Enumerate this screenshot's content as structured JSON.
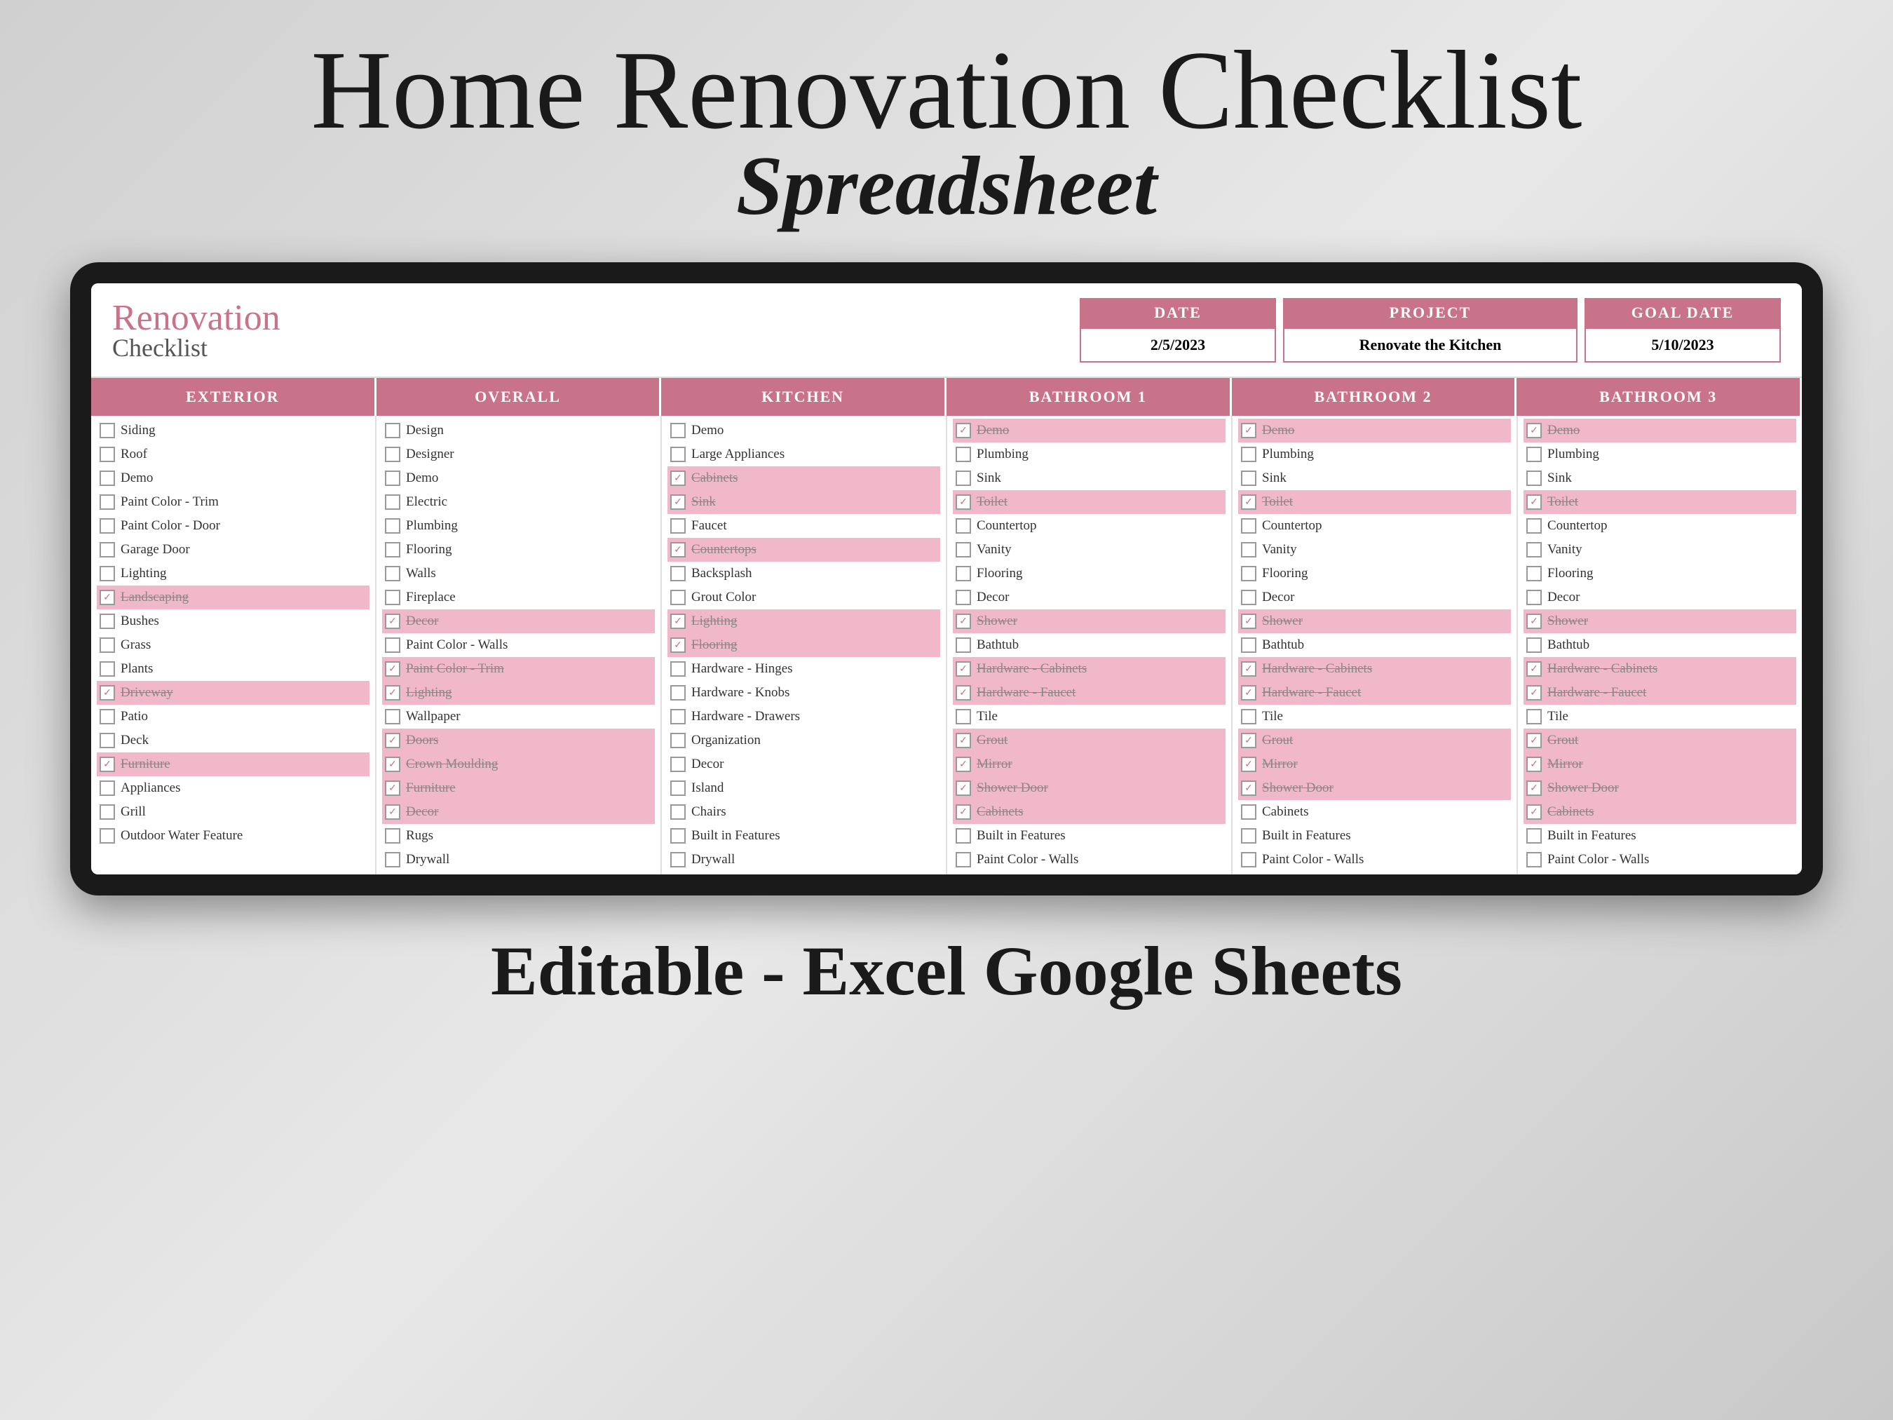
{
  "title": {
    "line1": "Home Renovation Checklist",
    "line2": "Spreadsheet"
  },
  "header": {
    "logo_script": "Renovation",
    "logo_normal": "Checklist",
    "date_label": "DATE",
    "date_value": "2/5/2023",
    "project_label": "PROJECT",
    "project_value": "Renovate the Kitchen",
    "goal_label": "GOAL DATE",
    "goal_value": "5/10/2023"
  },
  "columns": [
    {
      "header": "EXTERIOR",
      "items": [
        {
          "text": "Siding",
          "checked": false,
          "strikethrough": false
        },
        {
          "text": "Roof",
          "checked": false,
          "strikethrough": false
        },
        {
          "text": "Demo",
          "checked": false,
          "strikethrough": false
        },
        {
          "text": "Paint Color - Trim",
          "checked": false,
          "strikethrough": false
        },
        {
          "text": "Paint Color - Door",
          "checked": false,
          "strikethrough": false
        },
        {
          "text": "Garage Door",
          "checked": false,
          "strikethrough": false
        },
        {
          "text": "Lighting",
          "checked": false,
          "strikethrough": false
        },
        {
          "text": "Landscaping",
          "checked": true,
          "strikethrough": true
        },
        {
          "text": "Bushes",
          "checked": false,
          "strikethrough": false
        },
        {
          "text": "Grass",
          "checked": false,
          "strikethrough": false
        },
        {
          "text": "Plants",
          "checked": false,
          "strikethrough": false
        },
        {
          "text": "Driveway",
          "checked": true,
          "strikethrough": true
        },
        {
          "text": "Patio",
          "checked": false,
          "strikethrough": false
        },
        {
          "text": "Deck",
          "checked": false,
          "strikethrough": false
        },
        {
          "text": "Furniture",
          "checked": true,
          "strikethrough": true
        },
        {
          "text": "Appliances",
          "checked": false,
          "strikethrough": false
        },
        {
          "text": "Grill",
          "checked": false,
          "strikethrough": false
        },
        {
          "text": "Outdoor Water Feature",
          "checked": false,
          "strikethrough": false
        }
      ]
    },
    {
      "header": "OVERALL",
      "items": [
        {
          "text": "Design",
          "checked": false,
          "strikethrough": false
        },
        {
          "text": "Designer",
          "checked": false,
          "strikethrough": false
        },
        {
          "text": "Demo",
          "checked": false,
          "strikethrough": false
        },
        {
          "text": "Electric",
          "checked": false,
          "strikethrough": false
        },
        {
          "text": "Plumbing",
          "checked": false,
          "strikethrough": false
        },
        {
          "text": "Flooring",
          "checked": false,
          "strikethrough": false
        },
        {
          "text": "Walls",
          "checked": false,
          "strikethrough": false
        },
        {
          "text": "Fireplace",
          "checked": false,
          "strikethrough": false
        },
        {
          "text": "Decor",
          "checked": true,
          "strikethrough": true
        },
        {
          "text": "Paint Color - Walls",
          "checked": false,
          "strikethrough": false
        },
        {
          "text": "Paint Color - Trim",
          "checked": true,
          "strikethrough": true
        },
        {
          "text": "Lighting",
          "checked": true,
          "strikethrough": true
        },
        {
          "text": "Wallpaper",
          "checked": false,
          "strikethrough": false
        },
        {
          "text": "Doors",
          "checked": true,
          "strikethrough": true
        },
        {
          "text": "Crown Moulding",
          "checked": true,
          "strikethrough": true
        },
        {
          "text": "Furniture",
          "checked": true,
          "strikethrough": true
        },
        {
          "text": "Decor",
          "checked": true,
          "strikethrough": true
        },
        {
          "text": "Rugs",
          "checked": false,
          "strikethrough": false
        },
        {
          "text": "Drywall",
          "checked": false,
          "strikethrough": false
        }
      ]
    },
    {
      "header": "KITCHEN",
      "items": [
        {
          "text": "Demo",
          "checked": false,
          "strikethrough": false
        },
        {
          "text": "Large Appliances",
          "checked": false,
          "strikethrough": false
        },
        {
          "text": "Cabinets",
          "checked": true,
          "strikethrough": true
        },
        {
          "text": "Sink",
          "checked": true,
          "strikethrough": true
        },
        {
          "text": "Faucet",
          "checked": false,
          "strikethrough": false
        },
        {
          "text": "Countertops",
          "checked": true,
          "strikethrough": true
        },
        {
          "text": "Backsplash",
          "checked": false,
          "strikethrough": false
        },
        {
          "text": "Grout Color",
          "checked": false,
          "strikethrough": false
        },
        {
          "text": "Lighting",
          "checked": true,
          "strikethrough": true
        },
        {
          "text": "Flooring",
          "checked": true,
          "strikethrough": true
        },
        {
          "text": "Hardware - Hinges",
          "checked": false,
          "strikethrough": false
        },
        {
          "text": "Hardware - Knobs",
          "checked": false,
          "strikethrough": false
        },
        {
          "text": "Hardware - Drawers",
          "checked": false,
          "strikethrough": false
        },
        {
          "text": "Organization",
          "checked": false,
          "strikethrough": false
        },
        {
          "text": "Decor",
          "checked": false,
          "strikethrough": false
        },
        {
          "text": "Island",
          "checked": false,
          "strikethrough": false
        },
        {
          "text": "Chairs",
          "checked": false,
          "strikethrough": false
        },
        {
          "text": "Built in Features",
          "checked": false,
          "strikethrough": false
        },
        {
          "text": "Drywall",
          "checked": false,
          "strikethrough": false
        }
      ]
    },
    {
      "header": "BATHROOM 1",
      "items": [
        {
          "text": "Demo",
          "checked": true,
          "strikethrough": true
        },
        {
          "text": "Plumbing",
          "checked": false,
          "strikethrough": false
        },
        {
          "text": "Sink",
          "checked": false,
          "strikethrough": false
        },
        {
          "text": "Toilet",
          "checked": true,
          "strikethrough": true
        },
        {
          "text": "Countertop",
          "checked": false,
          "strikethrough": false
        },
        {
          "text": "Vanity",
          "checked": false,
          "strikethrough": false
        },
        {
          "text": "Flooring",
          "checked": false,
          "strikethrough": false
        },
        {
          "text": "Decor",
          "checked": false,
          "strikethrough": false
        },
        {
          "text": "Shower",
          "checked": true,
          "strikethrough": true
        },
        {
          "text": "Bathtub",
          "checked": false,
          "strikethrough": false
        },
        {
          "text": "Hardware - Cabinets",
          "checked": true,
          "strikethrough": true
        },
        {
          "text": "Hardware - Faucet",
          "checked": true,
          "strikethrough": true
        },
        {
          "text": "Tile",
          "checked": false,
          "strikethrough": false
        },
        {
          "text": "Grout",
          "checked": true,
          "strikethrough": true
        },
        {
          "text": "Mirror",
          "checked": true,
          "strikethrough": true
        },
        {
          "text": "Shower Door",
          "checked": true,
          "strikethrough": true
        },
        {
          "text": "Cabinets",
          "checked": true,
          "strikethrough": true
        },
        {
          "text": "Built in Features",
          "checked": false,
          "strikethrough": false
        },
        {
          "text": "Paint Color - Walls",
          "checked": false,
          "strikethrough": false
        }
      ]
    },
    {
      "header": "BATHROOM 2",
      "items": [
        {
          "text": "Demo",
          "checked": true,
          "strikethrough": true
        },
        {
          "text": "Plumbing",
          "checked": false,
          "strikethrough": false
        },
        {
          "text": "Sink",
          "checked": false,
          "strikethrough": false
        },
        {
          "text": "Toilet",
          "checked": true,
          "strikethrough": true
        },
        {
          "text": "Countertop",
          "checked": false,
          "strikethrough": false
        },
        {
          "text": "Vanity",
          "checked": false,
          "strikethrough": false
        },
        {
          "text": "Flooring",
          "checked": false,
          "strikethrough": false
        },
        {
          "text": "Decor",
          "checked": false,
          "strikethrough": false
        },
        {
          "text": "Shower",
          "checked": true,
          "strikethrough": true
        },
        {
          "text": "Bathtub",
          "checked": false,
          "strikethrough": false
        },
        {
          "text": "Hardware - Cabinets",
          "checked": true,
          "strikethrough": true
        },
        {
          "text": "Hardware - Faucet",
          "checked": true,
          "strikethrough": true
        },
        {
          "text": "Tile",
          "checked": false,
          "strikethrough": false
        },
        {
          "text": "Grout",
          "checked": true,
          "strikethrough": true
        },
        {
          "text": "Mirror",
          "checked": true,
          "strikethrough": true
        },
        {
          "text": "Shower Door",
          "checked": true,
          "strikethrough": true
        },
        {
          "text": "Cabinets",
          "checked": false,
          "strikethrough": false
        },
        {
          "text": "Built in Features",
          "checked": false,
          "strikethrough": false
        },
        {
          "text": "Paint Color - Walls",
          "checked": false,
          "strikethrough": false
        }
      ]
    },
    {
      "header": "BATHROOM 3",
      "items": [
        {
          "text": "Demo",
          "checked": true,
          "strikethrough": true
        },
        {
          "text": "Plumbing",
          "checked": false,
          "strikethrough": false
        },
        {
          "text": "Sink",
          "checked": false,
          "strikethrough": false
        },
        {
          "text": "Toilet",
          "checked": true,
          "strikethrough": true
        },
        {
          "text": "Countertop",
          "checked": false,
          "strikethrough": false
        },
        {
          "text": "Vanity",
          "checked": false,
          "strikethrough": false
        },
        {
          "text": "Flooring",
          "checked": false,
          "strikethrough": false
        },
        {
          "text": "Decor",
          "checked": false,
          "strikethrough": false
        },
        {
          "text": "Shower",
          "checked": true,
          "strikethrough": true
        },
        {
          "text": "Bathtub",
          "checked": false,
          "strikethrough": false
        },
        {
          "text": "Hardware - Cabinets",
          "checked": true,
          "strikethrough": true
        },
        {
          "text": "Hardware - Faucet",
          "checked": true,
          "strikethrough": true
        },
        {
          "text": "Tile",
          "checked": false,
          "strikethrough": false
        },
        {
          "text": "Grout",
          "checked": true,
          "strikethrough": true
        },
        {
          "text": "Mirror",
          "checked": true,
          "strikethrough": true
        },
        {
          "text": "Shower Door",
          "checked": true,
          "strikethrough": true
        },
        {
          "text": "Cabinets",
          "checked": true,
          "strikethrough": true
        },
        {
          "text": "Built in Features",
          "checked": false,
          "strikethrough": false
        },
        {
          "text": "Paint Color - Walls",
          "checked": false,
          "strikethrough": false
        }
      ]
    }
  ],
  "footer": "Editable - Excel Google Sheets"
}
